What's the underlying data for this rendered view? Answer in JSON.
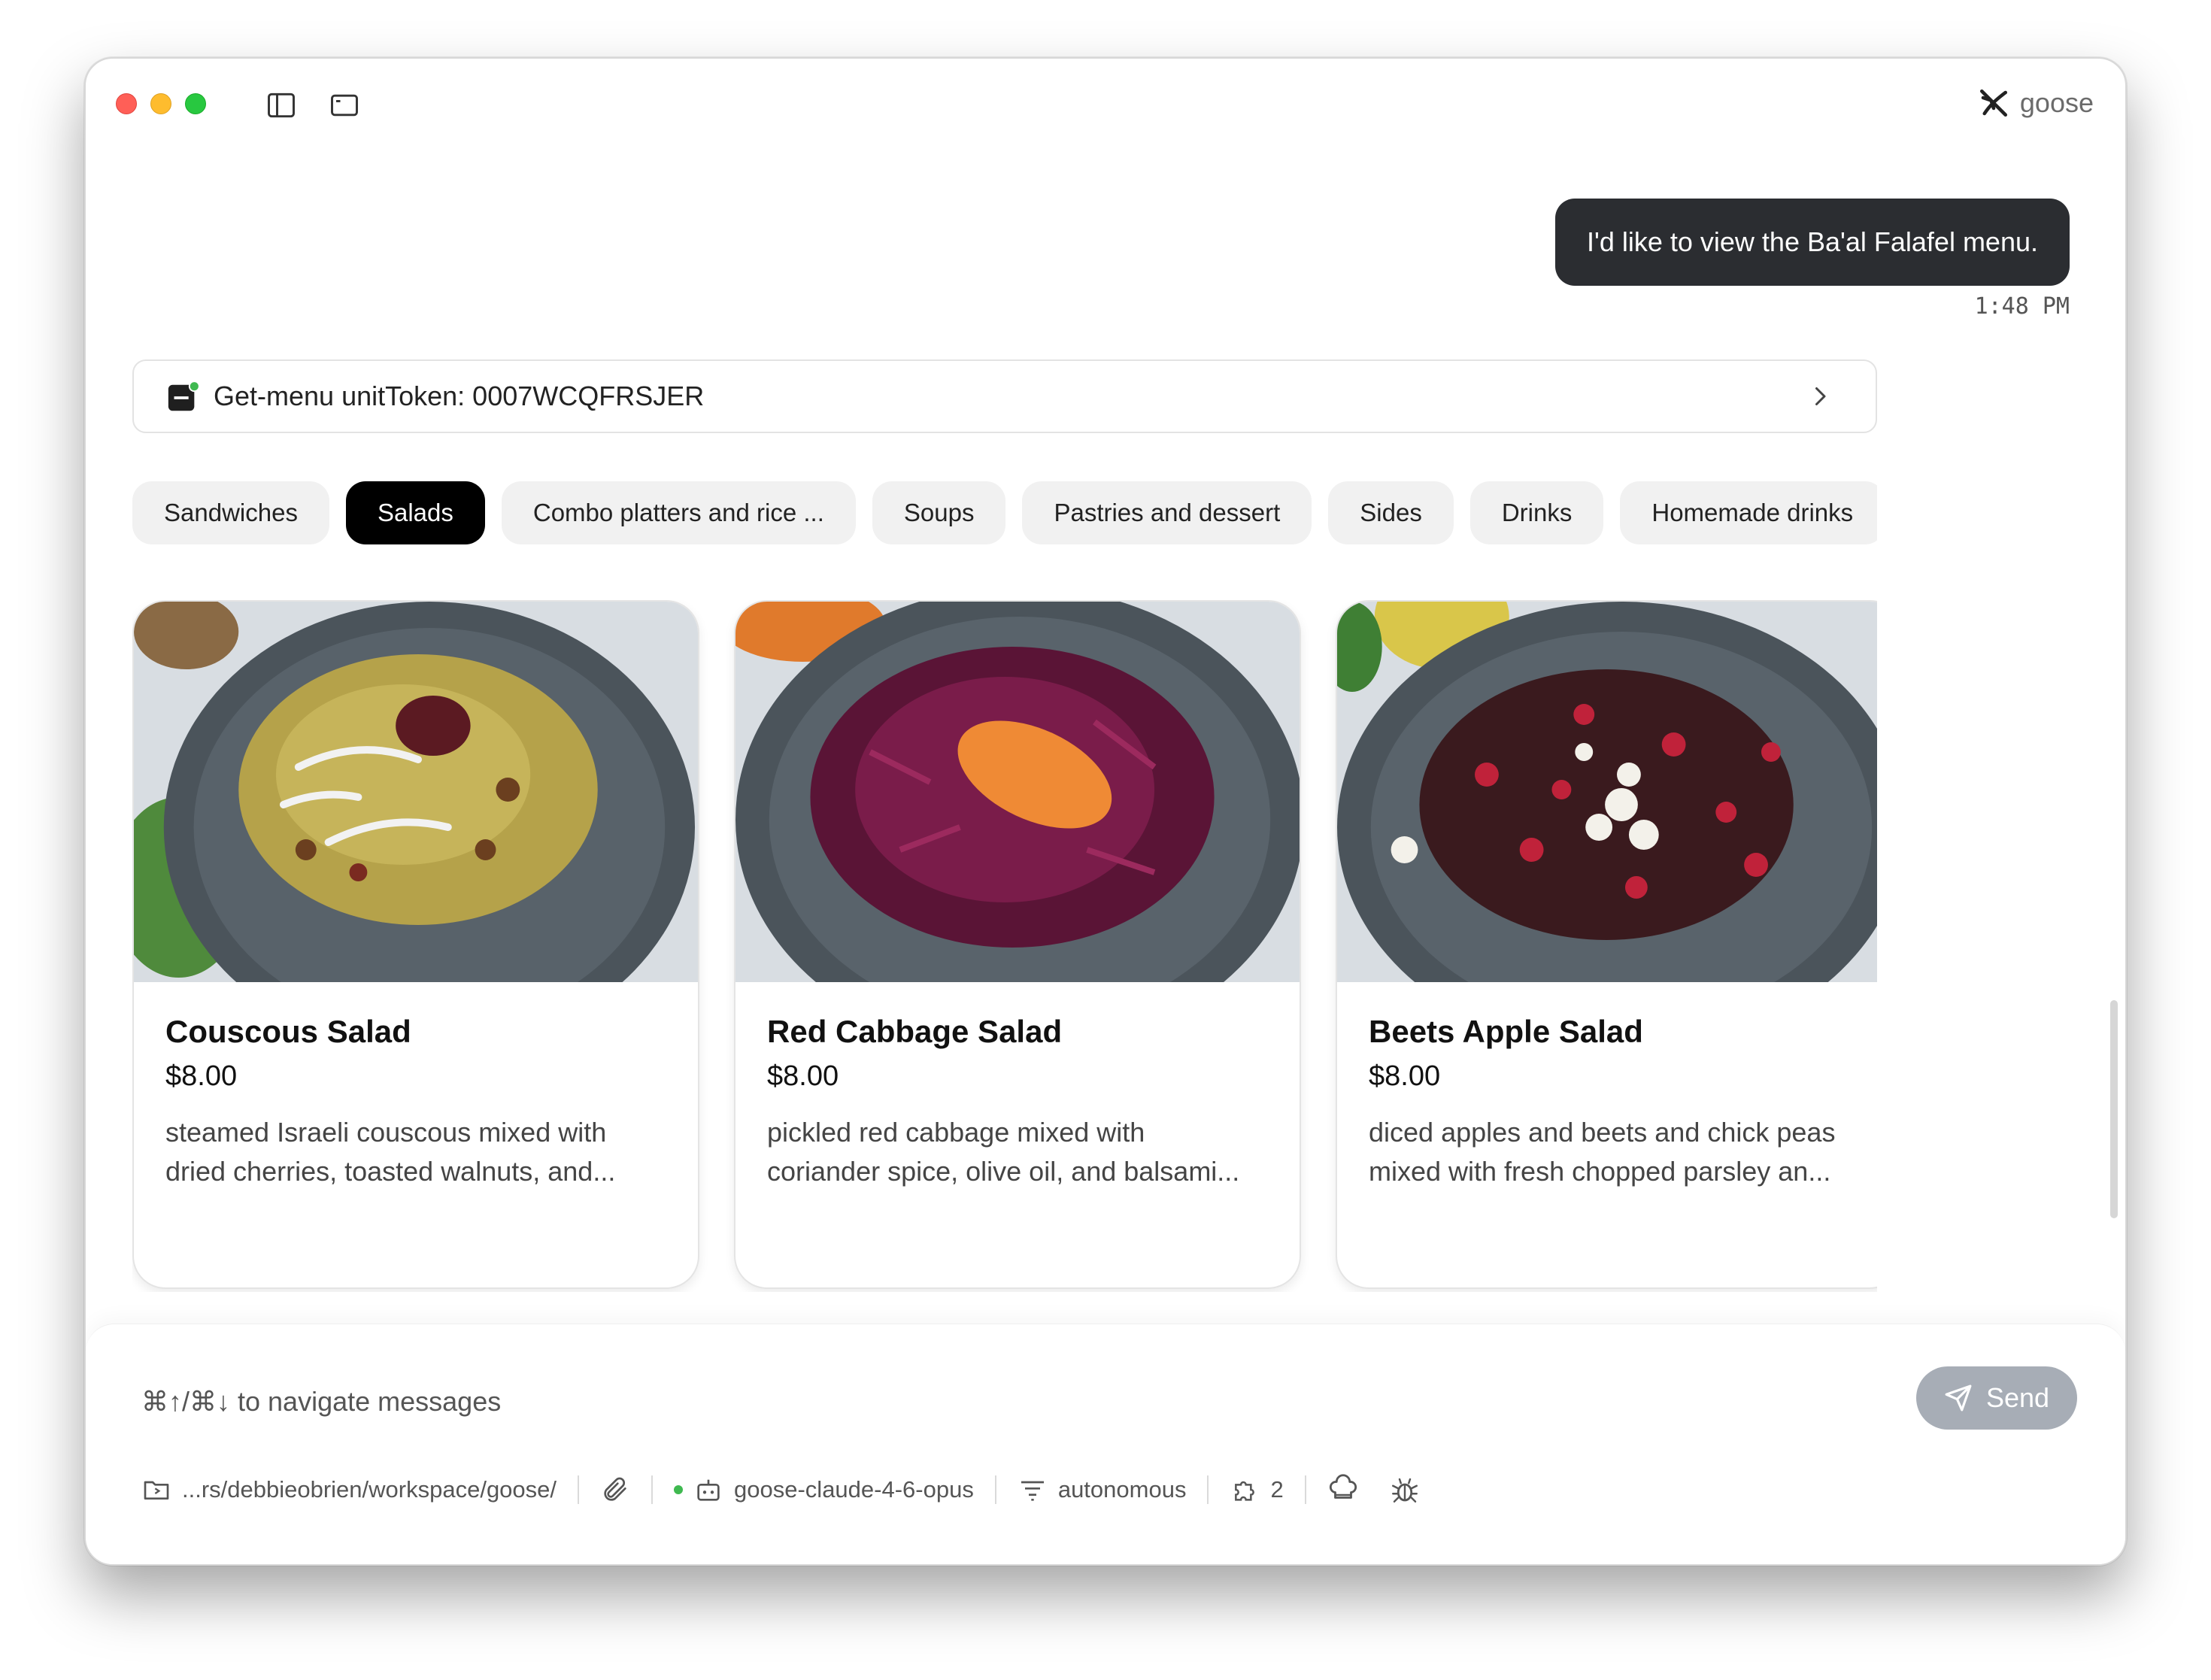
{
  "app": {
    "name": "goose"
  },
  "conversation": {
    "user_message": "I'd like to view the Ba'al Falafel menu.",
    "timestamp": "1:48 PM"
  },
  "tool_call": {
    "label": "Get-menu unitToken: 0007WCQFRSJER",
    "status_color": "#3fb950"
  },
  "menu": {
    "categories": [
      "Sandwiches",
      "Salads",
      "Combo platters and rice ...",
      "Soups",
      "Pastries and dessert",
      "Sides",
      "Drinks",
      "Homemade drinks"
    ],
    "active_category": "Salads",
    "items": [
      {
        "name": "Couscous Salad",
        "price": "$8.00",
        "desc_line1": "steamed Israeli couscous mixed with",
        "desc_line2": "dried cherries, toasted walnuts, and..."
      },
      {
        "name": "Red Cabbage Salad",
        "price": "$8.00",
        "desc_line1": "pickled red cabbage mixed with",
        "desc_line2": "coriander spice, olive oil, and balsami..."
      },
      {
        "name": "Beets Apple Salad",
        "price": "$8.00",
        "desc_line1": "diced apples and beets and chick peas",
        "desc_line2": "mixed with fresh chopped parsley an..."
      }
    ]
  },
  "composer": {
    "placeholder": "⌘↑/⌘↓ to navigate messages",
    "send_label": "Send",
    "working_dir": "...rs/debbieobrien/workspace/goose/",
    "model": "goose-claude-4-6-opus",
    "mode": "autonomous",
    "extensions_count": "2"
  },
  "icons": [
    "sidebar-toggle-icon",
    "window-icon",
    "goose-logo-icon",
    "terminal-icon",
    "chevron-right-icon",
    "send-icon",
    "folder-icon",
    "paperclip-icon",
    "bot-icon",
    "filter-icon",
    "puzzle-icon",
    "chef-hat-icon",
    "bug-icon"
  ]
}
